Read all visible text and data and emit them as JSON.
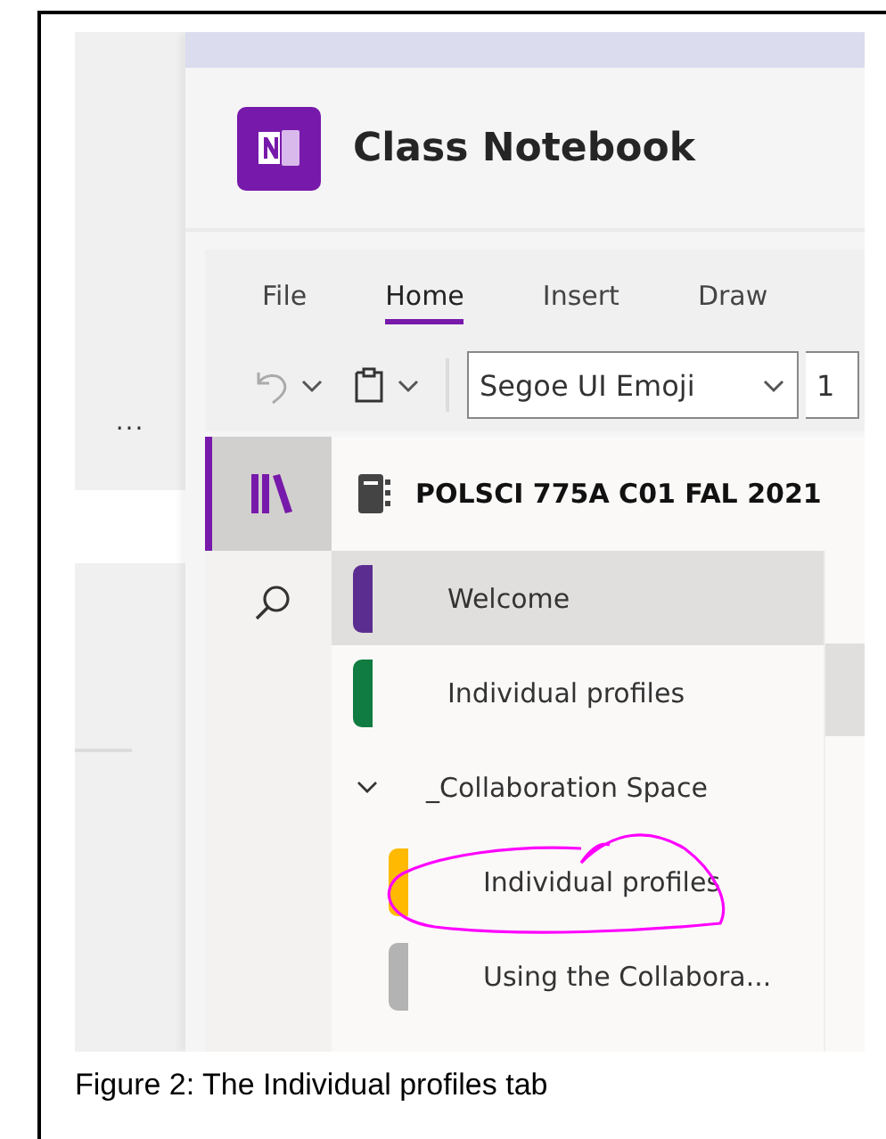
{
  "left_pane": {
    "more": "..."
  },
  "app_header": {
    "title": "Class Notebook"
  },
  "ribbon": {
    "tabs": [
      {
        "label": "File",
        "selected": false
      },
      {
        "label": "Home",
        "selected": true
      },
      {
        "label": "Insert",
        "selected": false
      },
      {
        "label": "Draw",
        "selected": false
      }
    ],
    "font": "Segoe UI Emoji",
    "font_size": "1"
  },
  "rail": [
    {
      "kind": "library",
      "selected": true
    },
    {
      "kind": "search",
      "selected": false
    }
  ],
  "notebook": {
    "title": "POLSCI 775A C01 FAL 2021"
  },
  "sections": [
    {
      "kind": "section",
      "label": "Welcome",
      "color": "#5c2d91",
      "selected": true
    },
    {
      "kind": "section",
      "label": "Individual profiles",
      "color": "#107c41",
      "selected": false
    },
    {
      "kind": "group",
      "label": "_Collaboration Space",
      "expanded": true,
      "children": [
        {
          "kind": "section",
          "label": "Individual profiles",
          "color": "#ffb900",
          "selected": false,
          "circled": true
        },
        {
          "kind": "section",
          "label": "Using the Collabora...",
          "color": "#b3b3b3",
          "selected": false
        }
      ]
    }
  ],
  "caption": "Figure 2: The Individual profiles tab"
}
